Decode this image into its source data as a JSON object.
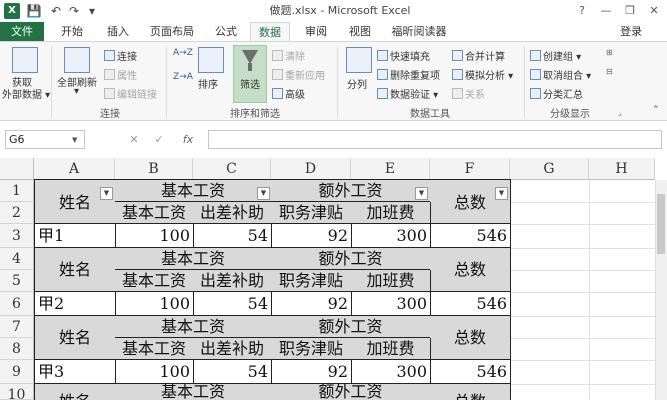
{
  "titlebar": {
    "app_icon": "X",
    "title": "做题.xlsx - Microsoft Excel",
    "help": "?",
    "minimize": "—",
    "restore": "❐",
    "close": "✕"
  },
  "quick_access": {
    "save": "💾",
    "undo": "↶",
    "redo": "↷",
    "customize": "▾"
  },
  "tabs": [
    "文件",
    "开始",
    "插入",
    "页面布局",
    "公式",
    "数据",
    "审阅",
    "视图",
    "福昕阅读器"
  ],
  "active_tab": "数据",
  "login": "登录",
  "ribbon": {
    "get_external": "获取\n外部数据",
    "get_external_l1": "获取",
    "get_external_l2": "外部数据 ▾",
    "refresh_all_l1": "全部刷新",
    "refresh_all_l2": "▾",
    "connections": "连接",
    "properties": "属性",
    "edit_links": "编辑链接",
    "group_connections": "连接",
    "sort_az": "A→Z",
    "sort_za": "Z→A",
    "sort": "排序",
    "filter": "筛选",
    "clear": "清除",
    "reapply": "重新应用",
    "advanced": "高级",
    "group_sort_filter": "排序和筛选",
    "text_to_columns": "分列",
    "flash_fill": "快速填充",
    "remove_duplicates": "删除重复项",
    "data_validation": "数据验证 ▾",
    "consolidate": "合并计算",
    "what_if": "模拟分析 ▾",
    "relationships": "关系",
    "group_data_tools": "数据工具",
    "group": "创建组 ▾",
    "ungroup": "取消组合 ▾",
    "subtotal": "分类汇总",
    "group_outline": "分级显示"
  },
  "formula_bar": {
    "name_box": "G6",
    "cancel": "✕",
    "enter": "✓",
    "fx": "fx",
    "formula": ""
  },
  "columns": [
    "A",
    "B",
    "C",
    "D",
    "E",
    "F",
    "G",
    "H"
  ],
  "rows": [
    "1",
    "2",
    "3",
    "4",
    "5",
    "6",
    "7",
    "8",
    "9",
    "10"
  ],
  "table": {
    "name_header": "姓名",
    "basic_salary": "基本工资",
    "extra_salary": "额外工资",
    "total": "总数",
    "sub_basic": "基本工资",
    "sub_travel": "出差补助",
    "sub_position": "职务津贴",
    "sub_overtime": "加班费",
    "records": [
      {
        "name": "甲1",
        "basic": "100",
        "travel": "54",
        "position": "92",
        "overtime": "300",
        "total": "546"
      },
      {
        "name": "甲2",
        "basic": "100",
        "travel": "54",
        "position": "92",
        "overtime": "300",
        "total": "546"
      },
      {
        "name": "甲3",
        "basic": "100",
        "travel": "54",
        "position": "92",
        "overtime": "300",
        "total": "546"
      }
    ]
  },
  "colors": {
    "excel_green": "#217346",
    "header_fill": "#d9d9d9"
  }
}
